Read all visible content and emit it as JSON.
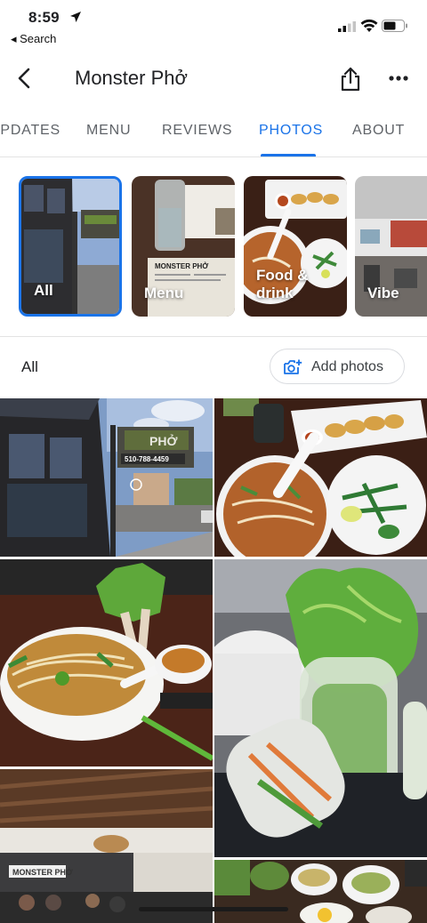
{
  "status_bar": {
    "time": "8:59",
    "back_label": "◂ Search"
  },
  "header": {
    "title": "Monster Phở"
  },
  "tabs": [
    {
      "label": "UPDATES",
      "active": false
    },
    {
      "label": "MENU",
      "active": false
    },
    {
      "label": "REVIEWS",
      "active": false
    },
    {
      "label": "PHOTOS",
      "active": true
    },
    {
      "label": "ABOUT",
      "active": false
    }
  ],
  "categories": [
    {
      "label": "All",
      "selected": true
    },
    {
      "label": "Menu",
      "selected": false
    },
    {
      "label": "Food &\ndrink",
      "selected": false
    },
    {
      "label": "Vibe",
      "selected": false
    }
  ],
  "filter": {
    "label": "All",
    "add_photos": "Add photos"
  },
  "photo_text": {
    "sign_name": "PHỞ",
    "sign_phone": "510-788-4459",
    "menu_heading": "MONSTER PHỞ",
    "wall_sign": "MONSTER PHỞ"
  },
  "colors": {
    "accent": "#1a73e8",
    "divider": "#e3e3e3"
  }
}
